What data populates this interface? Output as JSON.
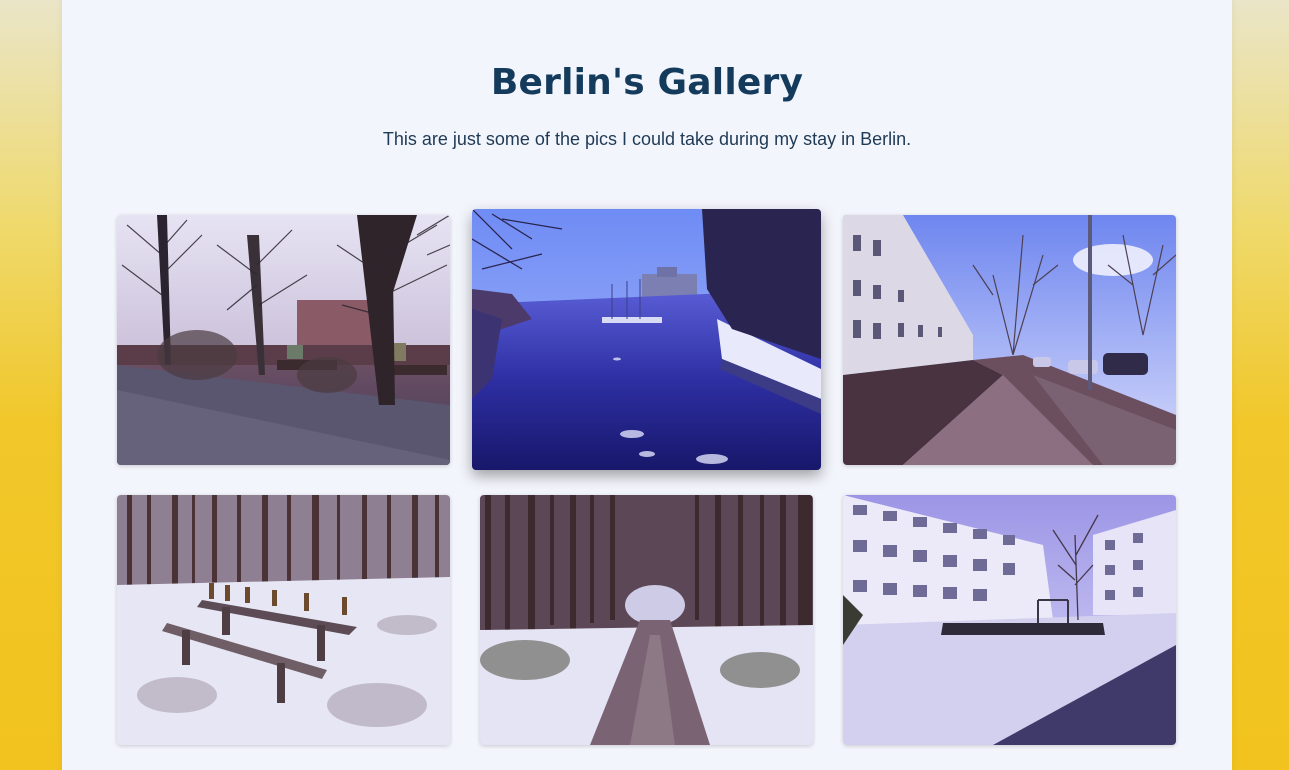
{
  "gallery": {
    "title": "Berlin's Gallery",
    "subtitle": "This are just some of the pics I could take during my stay in Berlin."
  },
  "colors": {
    "title": "#143a5c",
    "card_background": "#f3f5fc",
    "page_gradient_top": "#eae5c8",
    "page_gradient_bottom": "#f2c31e"
  }
}
